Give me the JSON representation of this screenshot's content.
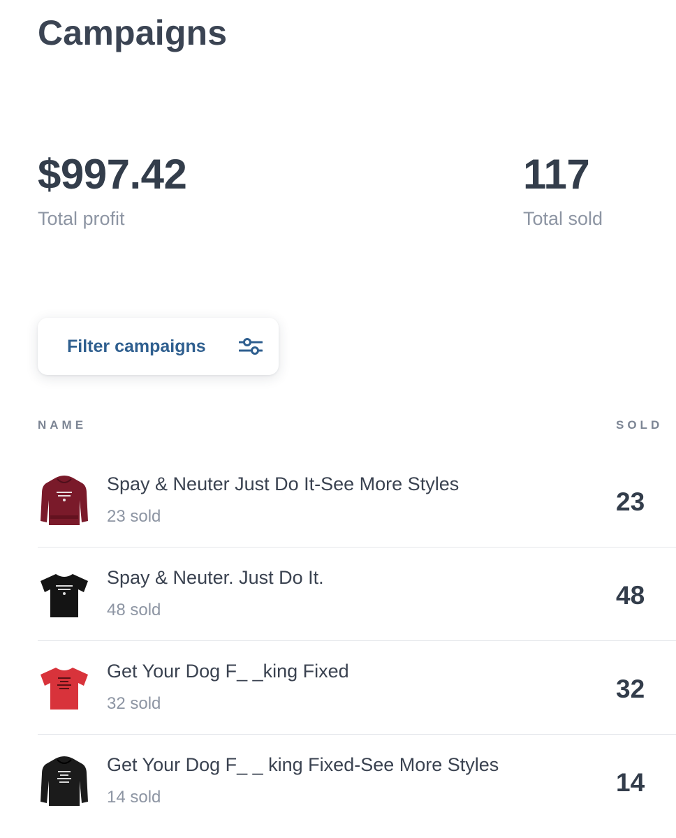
{
  "header": {
    "title": "Campaigns"
  },
  "stats": {
    "profit_value": "$997.42",
    "profit_label": "Total profit",
    "sold_value": "117",
    "sold_label": "Total sold"
  },
  "filter": {
    "label": "Filter campaigns",
    "icon": "sliders-icon"
  },
  "table": {
    "col_name": "NAME",
    "col_sold": "SOLD",
    "rows": [
      {
        "title": "Spay & Neuter Just Do It-See More  Styles",
        "sub": "23 sold",
        "count": "23",
        "product": "maroon-hoodie",
        "color": "#7a1a2a"
      },
      {
        "title": "Spay & Neuter. Just Do It.",
        "sub": "48 sold",
        "count": "48",
        "product": "black-tshirt",
        "color": "#141414"
      },
      {
        "title": "Get Your Dog F_ _king Fixed",
        "sub": "32 sold",
        "count": "32",
        "product": "red-tshirt",
        "color": "#d8333b"
      },
      {
        "title": "Get Your Dog F_ _ king Fixed-See More Styles",
        "sub": "14 sold",
        "count": "14",
        "product": "black-hoodie",
        "color": "#1b1b1b"
      }
    ]
  },
  "colors": {
    "accent": "#2f5f8f",
    "heading": "#3b4453",
    "muted": "#8d95a3"
  }
}
